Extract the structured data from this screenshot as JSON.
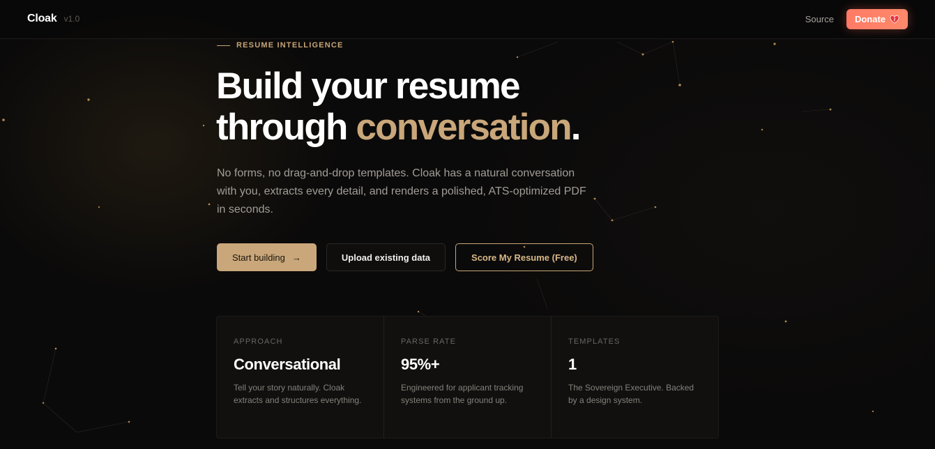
{
  "header": {
    "brand": "Cloak",
    "version": "v1.0",
    "source_label": "Source",
    "donate_label": "Donate",
    "donate_icon": "heart-icon"
  },
  "hero": {
    "eyebrow": "RESUME INTELLIGENCE",
    "headline_line1": "Build your resume",
    "headline_line2_plain": "through ",
    "headline_line2_accent": "conversation",
    "headline_period": ".",
    "lede": "No forms, no drag-and-drop templates. Cloak has a natural conversation with you, extracts every detail, and renders a polished, ATS-optimized PDF in seconds."
  },
  "actions": {
    "start_label": "Start building",
    "start_icon": "arrow-right-icon",
    "upload_label": "Upload existing data",
    "score_label": "Score My Resume (Free)"
  },
  "stats": [
    {
      "label": "APPROACH",
      "value": "Conversational",
      "desc": "Tell your story naturally. Cloak extracts and structures everything."
    },
    {
      "label": "PARSE RATE",
      "value": "95%+",
      "desc": "Engineered for applicant tracking systems from the ground up."
    },
    {
      "label": "TEMPLATES",
      "value": "1",
      "desc": "The Sovereign Executive. Backed by a design system."
    }
  ],
  "colors": {
    "background": "#0b0a0a",
    "accent_gold": "#c9a77a",
    "donate_coral": "#ff7a66",
    "text_muted": "#a19d97"
  }
}
